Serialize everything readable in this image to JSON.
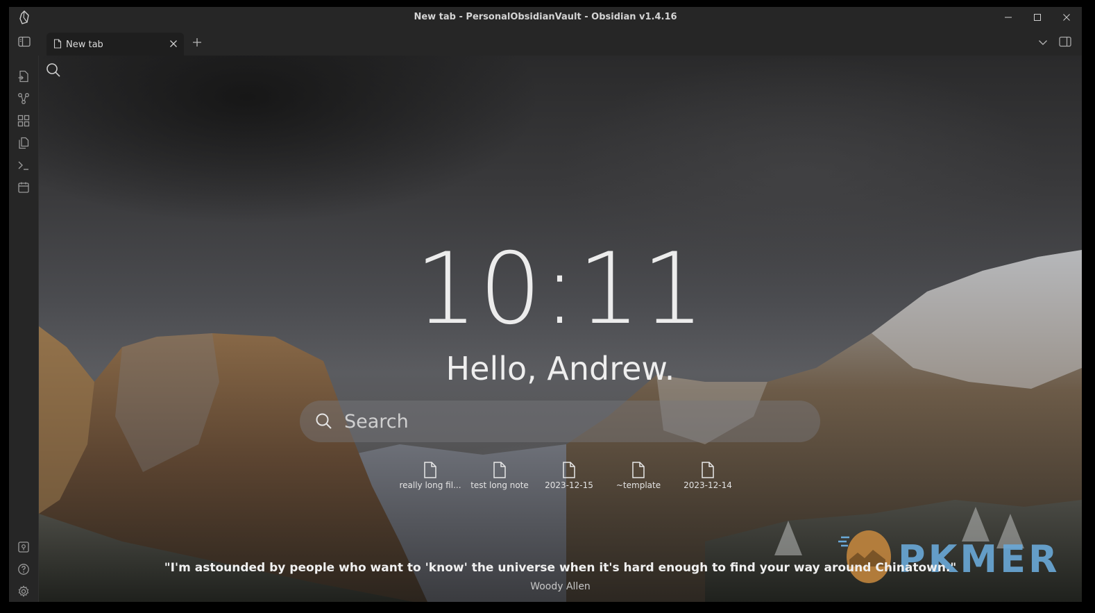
{
  "window": {
    "title": "New tab - PersonalObsidianVault - Obsidian v1.4.16"
  },
  "tabs": [
    {
      "label": "New tab"
    }
  ],
  "ribbon": {
    "top_icons": [
      "open-quick-switcher-icon",
      "graph-view-icon",
      "canvas-icon",
      "daily-notes-icon",
      "command-palette-icon",
      "calendar-icon"
    ],
    "bottom_icons": [
      "vault-switcher-icon",
      "help-icon",
      "settings-icon"
    ]
  },
  "home": {
    "clock": "10:11",
    "greeting": "Hello, Andrew.",
    "search_placeholder": "Search",
    "recent_files": [
      {
        "name": "really long fil..."
      },
      {
        "name": "test long note"
      },
      {
        "name": "2023-12-15"
      },
      {
        "name": "~template"
      },
      {
        "name": "2023-12-14"
      }
    ],
    "quote": "\"I'm astounded by people who want to 'know' the universe when it's hard enough to find your way around Chinatown.\"",
    "quote_author": "Woody Allen"
  },
  "watermark": {
    "text": "PKMER"
  },
  "colors": {
    "chrome": "#262626",
    "tab_active": "#1e1e1e",
    "watermark": "#6aa9d8"
  }
}
